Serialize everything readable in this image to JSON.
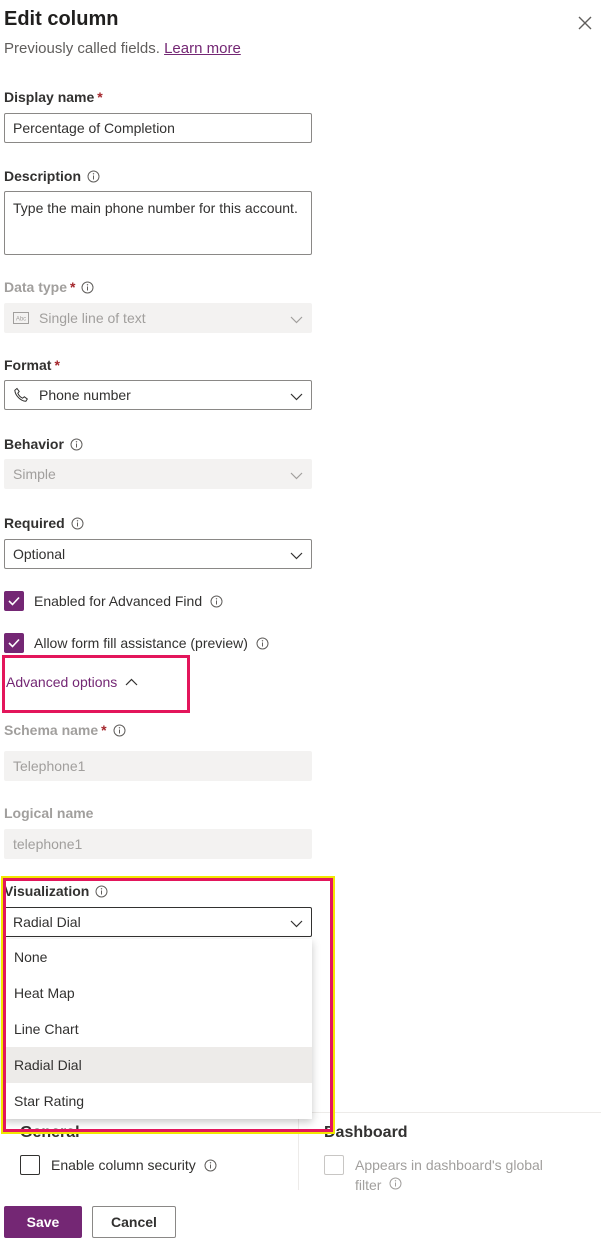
{
  "header": {
    "title": "Edit column",
    "subtitle": "Previously called fields.",
    "learn_more": "Learn more"
  },
  "fields": {
    "display_name": {
      "label": "Display name",
      "value": "Percentage of Completion"
    },
    "description": {
      "label": "Description",
      "value": "Type the main phone number for this account."
    },
    "data_type": {
      "label": "Data type",
      "value": "Single line of text",
      "icon": "abc-text-icon"
    },
    "format": {
      "label": "Format",
      "value": "Phone number",
      "icon": "phone-icon"
    },
    "behavior": {
      "label": "Behavior",
      "value": "Simple"
    },
    "required": {
      "label": "Required",
      "value": "Optional"
    },
    "required_marker": "*"
  },
  "checks": {
    "advanced_find": "Enabled for Advanced Find",
    "form_fill": "Allow form fill assistance (preview)"
  },
  "advanced": {
    "toggle_label": "Advanced options",
    "schema_name": {
      "label": "Schema name",
      "value": "Telephone1"
    },
    "logical_name": {
      "label": "Logical name",
      "value": "telephone1"
    },
    "visualization": {
      "label": "Visualization",
      "value": "Radial Dial",
      "options": [
        "None",
        "Heat Map",
        "Line Chart",
        "Radial Dial",
        "Star Rating"
      ]
    }
  },
  "security": {
    "general_heading": "General",
    "enable_security": "Enable column security",
    "dashboard_heading": "Dashboard",
    "dashboard_filter_line1": "Appears in dashboard's global",
    "dashboard_filter_line2": "filter"
  },
  "footer": {
    "save": "Save",
    "cancel": "Cancel"
  },
  "colors": {
    "accent": "#742774",
    "highlight": "#e3165b",
    "required": "#a4262c"
  }
}
